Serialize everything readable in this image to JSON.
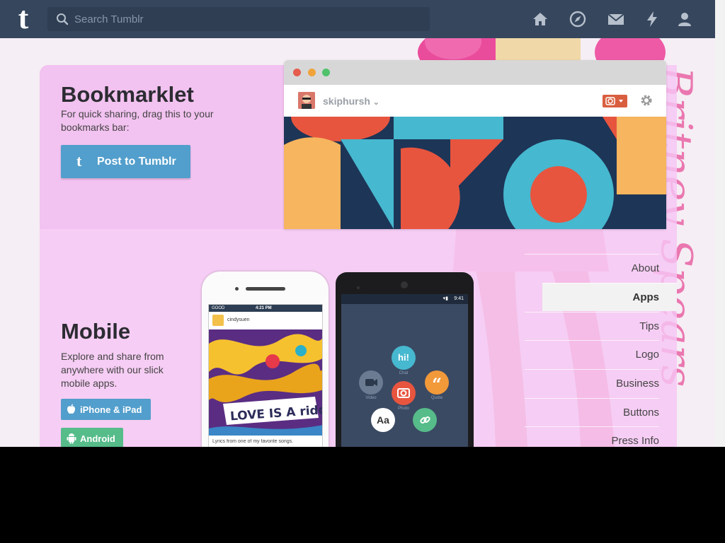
{
  "header": {
    "search_placeholder": "Search Tumblr",
    "logo_letter": "t",
    "nav_icons": [
      "home-icon",
      "explore-icon",
      "inbox-icon",
      "activity-icon",
      "account-icon"
    ]
  },
  "bookmarklet": {
    "title": "Bookmarklet",
    "description": "For quick sharing, drag this to your bookmarks bar:",
    "button_label": "Post to Tumblr",
    "button_icon": "t"
  },
  "browser_preview": {
    "username": "skiphursh"
  },
  "mobile": {
    "title": "Mobile",
    "description": "Explore and share from anywhere with our slick mobile apps.",
    "iphone_label": "iPhone & iPad",
    "android_label": "Android"
  },
  "iphone_screen": {
    "carrier": "GOOD",
    "time": "4:21 PM",
    "username": "cindysuen",
    "caption": "Lyrics from one of my favorite songs.",
    "art_text": "LOVE IS A riddle"
  },
  "android_screen": {
    "time": "9:41",
    "bubbles": {
      "chat": "hi!",
      "chat_label": "Chat",
      "video_label": "Video",
      "photo_label": "Photo",
      "quote": "“",
      "quote_label": "Quote",
      "text": "Aa",
      "link_label": "Link"
    }
  },
  "side_nav": {
    "items": [
      "About",
      "Apps",
      "Tips",
      "Logo",
      "Business",
      "Buttons",
      "Press Info"
    ],
    "active": "Apps"
  },
  "colors": {
    "header_bg": "#36465d",
    "accent_blue": "#529ecc",
    "android_green": "#56bc8a",
    "panel_pink": "#f2c2f0"
  }
}
